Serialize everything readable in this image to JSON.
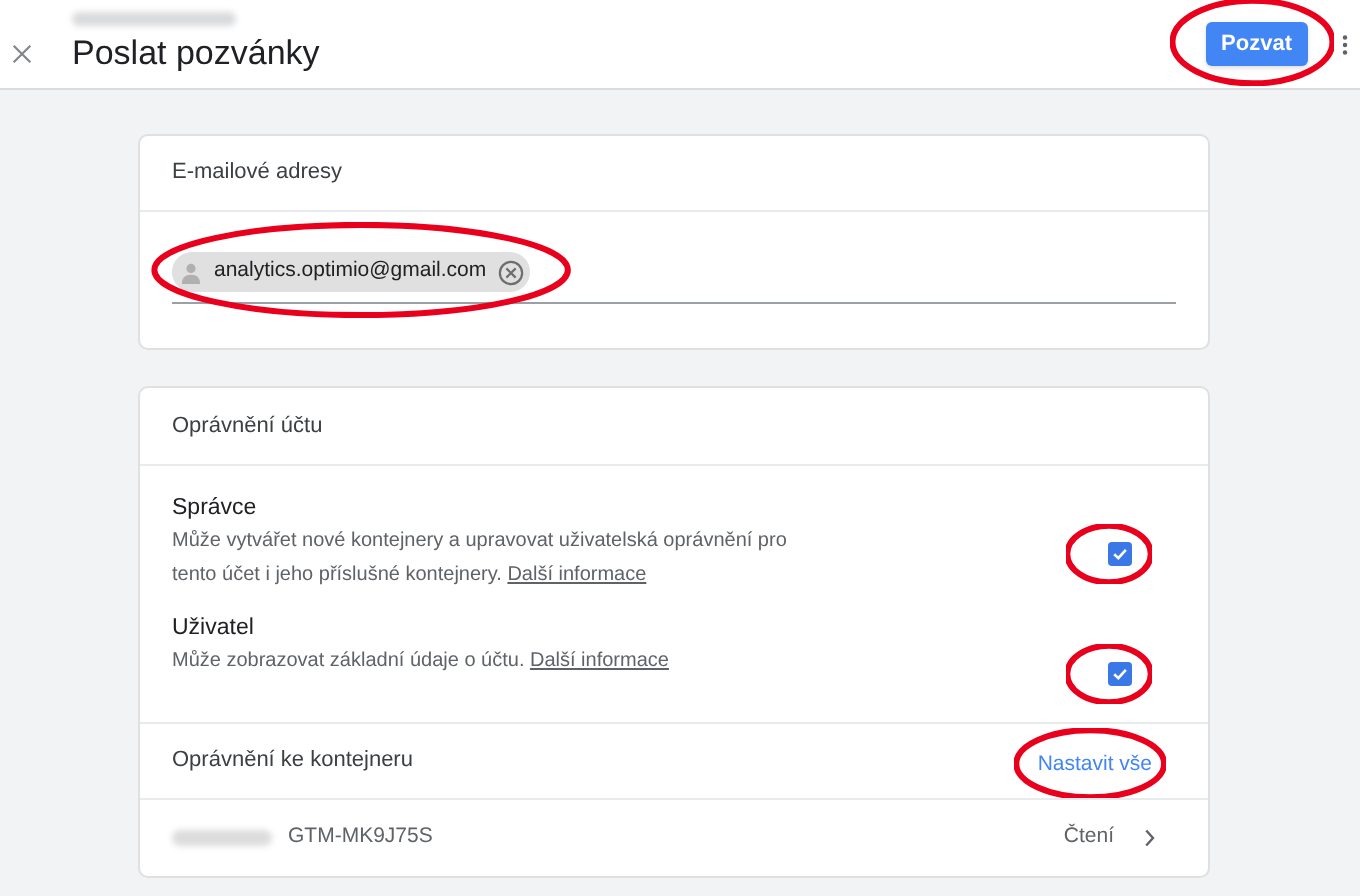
{
  "header": {
    "title": "Poslat pozvánky",
    "invite_button": {
      "label": "Pozvat",
      "highlighted": true
    }
  },
  "emails": {
    "title": "E-mailové adresy",
    "chips": [
      {
        "label": "analytics.optimio@gmail.com",
        "highlighted": true
      }
    ]
  },
  "account_permissions": {
    "title": "Oprávnění účtu",
    "roles": [
      {
        "name": "Správce",
        "description": "Může vytvářet nové kontejnery a upravovat uživatelská oprávnění pro tento účet i jeho příslušné kontejnery.",
        "link": "Další informace",
        "checked": true,
        "highlighted": true
      },
      {
        "name": "Uživatel",
        "description": "Může zobrazovat základní údaje o účtu.",
        "link": "Další informace",
        "checked": true,
        "highlighted": true
      }
    ]
  },
  "container_permissions": {
    "title": "Oprávnění ke kontejneru",
    "set_all": {
      "label": "Nastavit vše",
      "highlighted": true
    },
    "rows": [
      {
        "container_id": "GTM-MK9J75S",
        "permission": "Čtení"
      }
    ]
  }
}
